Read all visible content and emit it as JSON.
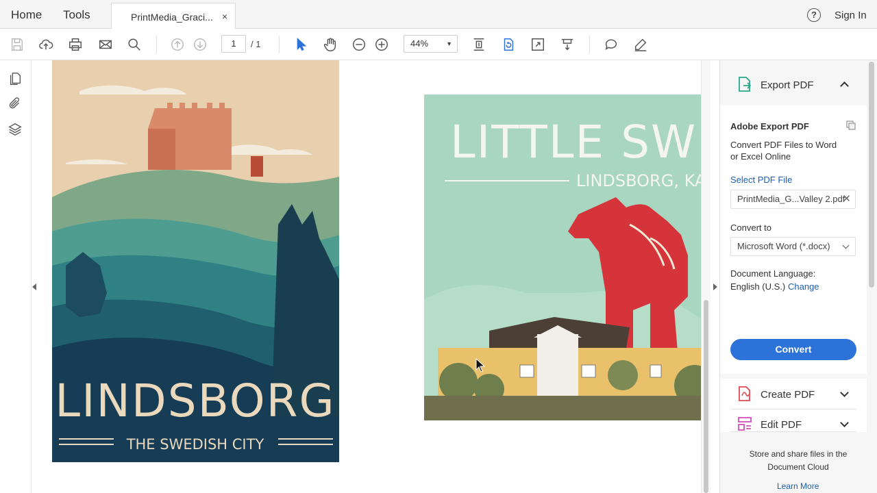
{
  "topbar": {
    "home": "Home",
    "tools": "Tools",
    "doc_tab": "PrintMedia_Graci...",
    "close": "×",
    "help": "?",
    "signin": "Sign In"
  },
  "toolbar": {
    "page_current": "1",
    "page_total": "/ 1",
    "zoom": "44%",
    "icons": [
      "save-icon",
      "upload-icon",
      "print-icon",
      "mail-icon",
      "search-icon",
      "prev-page-icon",
      "next-page-icon",
      "select-arrow-icon",
      "hand-icon",
      "zoom-out-icon",
      "zoom-in-icon",
      "fit-page-icon",
      "rotate-icon",
      "full-screen-icon",
      "scroll-mode-icon",
      "comment-icon",
      "sign-icon"
    ]
  },
  "document": {
    "poster1": {
      "title": "LINDSBORG",
      "subtitle": "THE SWEDISH CITY"
    },
    "poster2": {
      "title": "LITTLE SWEDE",
      "subtitle": "LINDSBORG, KANSAS"
    }
  },
  "right_panel": {
    "export_header": "Export PDF",
    "card_title": "Adobe Export PDF",
    "card_desc_line1": "Convert PDF Files to Word",
    "card_desc_line2": "or Excel Online",
    "select_label": "Select PDF File",
    "file_name": "PrintMedia_G...Valley 2.pdf",
    "convert_to_label": "Convert to",
    "format": "Microsoft Word (*.docx)",
    "lang_label": "Document Language:",
    "lang_value": "English (U.S.)",
    "change": "Change",
    "convert": "Convert",
    "create_pdf": "Create PDF",
    "edit_pdf": "Edit PDF",
    "cloud_note": "Store and share files in the Document Cloud",
    "learn_more": "Learn More"
  },
  "colors": {
    "accent": "#2d72d9",
    "export_green": "#27a889",
    "create_red": "#e34850",
    "edit_pink": "#d34fbc"
  }
}
